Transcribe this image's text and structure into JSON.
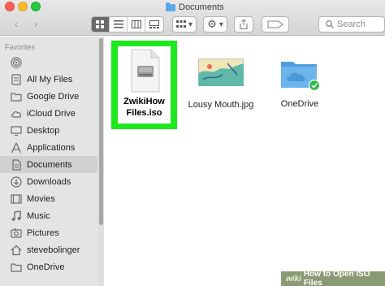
{
  "window": {
    "title": "Documents"
  },
  "toolbar": {
    "back_glyph": "‹",
    "forward_glyph": "›",
    "search_placeholder": "Search",
    "view_modes": [
      "icon-view",
      "list-view",
      "column-view",
      "gallery-view"
    ],
    "selected_view": "icon-view"
  },
  "sidebar": {
    "heading": "Favorites",
    "items": [
      {
        "label": "",
        "icon": "airdrop-icon"
      },
      {
        "label": "All My Files",
        "icon": "all-files-icon"
      },
      {
        "label": "Google Drive",
        "icon": "folder-icon"
      },
      {
        "label": "iCloud Drive",
        "icon": "cloud-icon"
      },
      {
        "label": "Desktop",
        "icon": "desktop-icon"
      },
      {
        "label": "Applications",
        "icon": "applications-icon"
      },
      {
        "label": "Documents",
        "icon": "documents-icon",
        "selected": true
      },
      {
        "label": "Downloads",
        "icon": "downloads-icon"
      },
      {
        "label": "Movies",
        "icon": "movies-icon"
      },
      {
        "label": "Music",
        "icon": "music-icon"
      },
      {
        "label": "Pictures",
        "icon": "pictures-icon"
      },
      {
        "label": "stevebolinger",
        "icon": "home-icon"
      },
      {
        "label": "OneDrive",
        "icon": "folder-icon"
      }
    ]
  },
  "files": [
    {
      "name_line1": "ZwikiHow",
      "name_line2": "Files.iso",
      "type": "disk-image",
      "highlighted": true
    },
    {
      "name_line1": "Lousy Mouth.jpg",
      "name_line2": "",
      "type": "image"
    },
    {
      "name_line1": "OneDrive",
      "name_line2": "",
      "type": "synced-folder"
    }
  ],
  "badge": {
    "brand": "wiki",
    "text": "How to Open ISO Files"
  },
  "colors": {
    "highlight": "#1ee81e",
    "folder_blue": "#5aa8e8",
    "sync_green": "#2db84a",
    "badge_bg": "#8a9a74"
  }
}
